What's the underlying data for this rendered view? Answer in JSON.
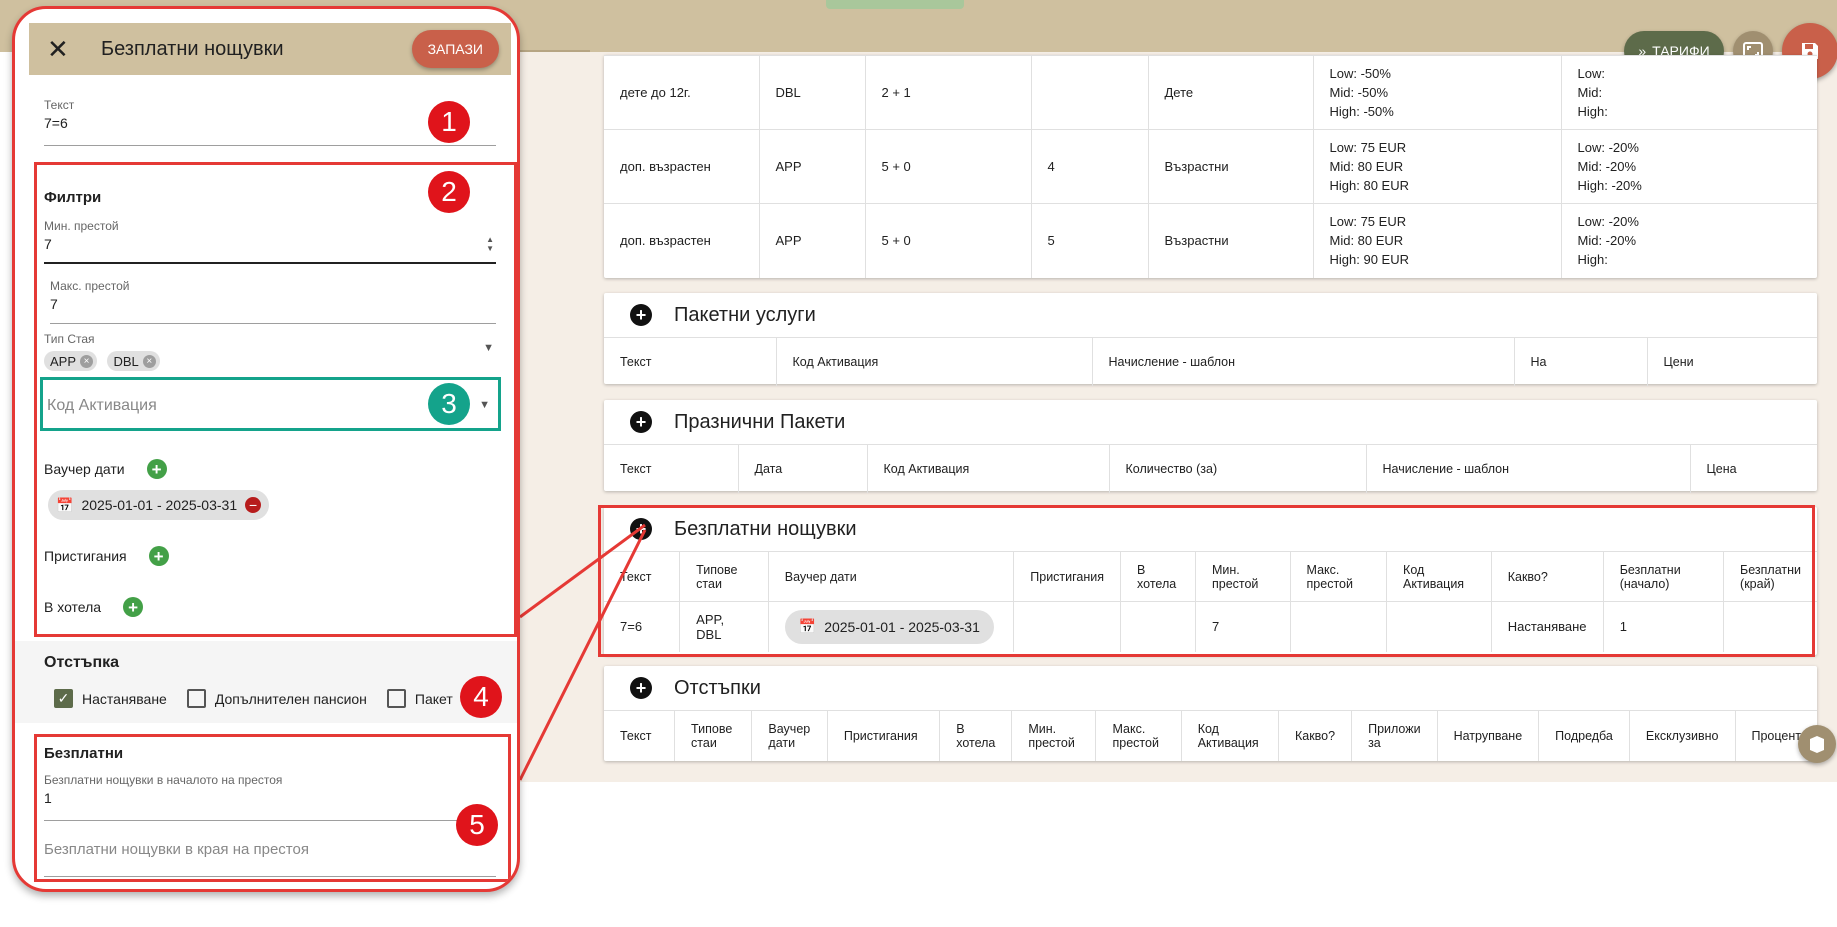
{
  "header": {
    "tarifi_label": "ТАРИФИ"
  },
  "age_table": {
    "rows": [
      {
        "c1": "дете до 12г.",
        "c2": "DBL",
        "c3": "2 + 1",
        "c4": "",
        "c5": "Дете",
        "p1": [
          "Low:  -50%",
          "Mid:  -50%",
          "High:  -50%"
        ],
        "p2": [
          "Low:",
          "Mid:",
          "High:"
        ]
      },
      {
        "c1": "доп. възрастен",
        "c2": "APP",
        "c3": "5 + 0",
        "c4": "4",
        "c5": "Възрастни",
        "p1": [
          "Low:   75 EUR",
          "Mid:   80 EUR",
          "High:   80 EUR"
        ],
        "p2": [
          "Low:   -20%",
          "Mid:   -20%",
          "High:   -20%"
        ]
      },
      {
        "c1": "доп. възрастен",
        "c2": "APP",
        "c3": "5 + 0",
        "c4": "5",
        "c5": "Възрастни",
        "p1": [
          "Low:   75 EUR",
          "Mid:   80 EUR",
          "High:   90 EUR"
        ],
        "p2": [
          "Low:   -20%",
          "Mid:   -20%",
          "High:"
        ]
      }
    ]
  },
  "package_services": {
    "title": "Пакетни услуги",
    "headers": [
      "Текст",
      "Код Активация",
      "Начисление - шаблон",
      "На",
      "Цени"
    ]
  },
  "holiday_packages": {
    "title": "Празнични Пакети",
    "headers": [
      "Текст",
      "Дата",
      "Код Активация",
      "Количество (за)",
      "Начисление - шаблон",
      "Цена"
    ]
  },
  "free_nights": {
    "title": "Безплатни нощувки",
    "headers": [
      "Текст",
      "Типове стаи",
      "Ваучер дати",
      "Пристигания",
      "В хотела",
      "Мин. престой",
      "Макс. престой",
      "Код Активация",
      "Какво?",
      "Безплатни (начало)",
      "Безплатни (край)"
    ],
    "row": {
      "text": "7=6",
      "rooms": "APP, DBL",
      "dates": "2025-01-01 - 2025-03-31",
      "arrivals": "",
      "in_hotel": "",
      "min": "7",
      "max": "",
      "code": "",
      "what": "Настаняване",
      "start": "1",
      "end": ""
    }
  },
  "discounts": {
    "title": "Отстъпки",
    "headers": [
      "Текст",
      "Типове стаи",
      "Ваучер дати",
      "Пристигания",
      "В хотела",
      "Мин. престой",
      "Макс. престой",
      "Код Активация",
      "Какво?",
      "Приложи за",
      "Натрупване",
      "Подредба",
      "Ексклузивно",
      "Процент"
    ]
  },
  "panel": {
    "title": "Безплатни нощувки",
    "save_label": "ЗАПАЗИ",
    "text_label": "Текст",
    "text_value": "7=6",
    "filters_title": "Филтри",
    "min_label": "Мин. престой",
    "min_value": "7",
    "max_label": "Макс. престой",
    "max_value": "7",
    "room_type_label": "Тип Стая",
    "room_chips": [
      "APP",
      "DBL"
    ],
    "activation_placeholder": "Код Активация",
    "voucher_label": "Ваучер дати",
    "voucher_chip": "2025-01-01 - 2025-03-31",
    "arrivals_label": "Пристигания",
    "in_hotel_label": "В хотела",
    "discount_title": "Отстъпка",
    "cb_accommodation": "Настаняване",
    "cb_board": "Допълнителен пансион",
    "cb_package": "Пакет",
    "free_title": "Безплатни",
    "free_start_label": "Безплатни нощувки в началото на престоя",
    "free_start_value": "1",
    "free_end_placeholder": "Безплатни нощувки в края на престоя"
  },
  "markers": [
    "1",
    "2",
    "3",
    "4",
    "5"
  ]
}
